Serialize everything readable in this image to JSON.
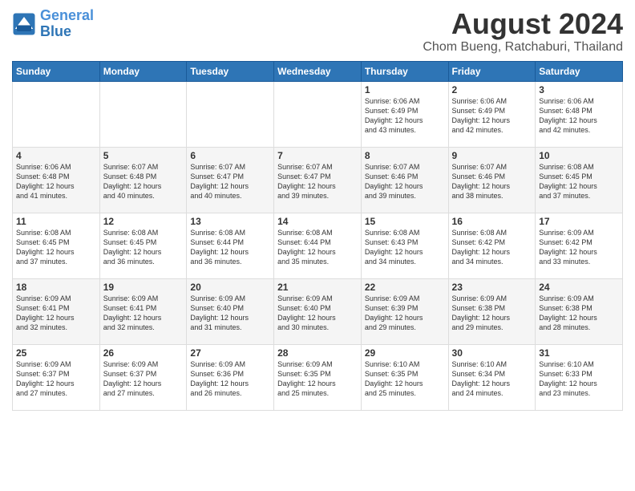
{
  "header": {
    "logo_line1": "General",
    "logo_line2": "Blue",
    "title": "August 2024",
    "subtitle": "Chom Bueng, Ratchaburi, Thailand"
  },
  "days_of_week": [
    "Sunday",
    "Monday",
    "Tuesday",
    "Wednesday",
    "Thursday",
    "Friday",
    "Saturday"
  ],
  "weeks": [
    [
      {
        "day": "",
        "info": ""
      },
      {
        "day": "",
        "info": ""
      },
      {
        "day": "",
        "info": ""
      },
      {
        "day": "",
        "info": ""
      },
      {
        "day": "1",
        "info": "Sunrise: 6:06 AM\nSunset: 6:49 PM\nDaylight: 12 hours\nand 43 minutes."
      },
      {
        "day": "2",
        "info": "Sunrise: 6:06 AM\nSunset: 6:49 PM\nDaylight: 12 hours\nand 42 minutes."
      },
      {
        "day": "3",
        "info": "Sunrise: 6:06 AM\nSunset: 6:48 PM\nDaylight: 12 hours\nand 42 minutes."
      }
    ],
    [
      {
        "day": "4",
        "info": "Sunrise: 6:06 AM\nSunset: 6:48 PM\nDaylight: 12 hours\nand 41 minutes."
      },
      {
        "day": "5",
        "info": "Sunrise: 6:07 AM\nSunset: 6:48 PM\nDaylight: 12 hours\nand 40 minutes."
      },
      {
        "day": "6",
        "info": "Sunrise: 6:07 AM\nSunset: 6:47 PM\nDaylight: 12 hours\nand 40 minutes."
      },
      {
        "day": "7",
        "info": "Sunrise: 6:07 AM\nSunset: 6:47 PM\nDaylight: 12 hours\nand 39 minutes."
      },
      {
        "day": "8",
        "info": "Sunrise: 6:07 AM\nSunset: 6:46 PM\nDaylight: 12 hours\nand 39 minutes."
      },
      {
        "day": "9",
        "info": "Sunrise: 6:07 AM\nSunset: 6:46 PM\nDaylight: 12 hours\nand 38 minutes."
      },
      {
        "day": "10",
        "info": "Sunrise: 6:08 AM\nSunset: 6:45 PM\nDaylight: 12 hours\nand 37 minutes."
      }
    ],
    [
      {
        "day": "11",
        "info": "Sunrise: 6:08 AM\nSunset: 6:45 PM\nDaylight: 12 hours\nand 37 minutes."
      },
      {
        "day": "12",
        "info": "Sunrise: 6:08 AM\nSunset: 6:45 PM\nDaylight: 12 hours\nand 36 minutes."
      },
      {
        "day": "13",
        "info": "Sunrise: 6:08 AM\nSunset: 6:44 PM\nDaylight: 12 hours\nand 36 minutes."
      },
      {
        "day": "14",
        "info": "Sunrise: 6:08 AM\nSunset: 6:44 PM\nDaylight: 12 hours\nand 35 minutes."
      },
      {
        "day": "15",
        "info": "Sunrise: 6:08 AM\nSunset: 6:43 PM\nDaylight: 12 hours\nand 34 minutes."
      },
      {
        "day": "16",
        "info": "Sunrise: 6:08 AM\nSunset: 6:42 PM\nDaylight: 12 hours\nand 34 minutes."
      },
      {
        "day": "17",
        "info": "Sunrise: 6:09 AM\nSunset: 6:42 PM\nDaylight: 12 hours\nand 33 minutes."
      }
    ],
    [
      {
        "day": "18",
        "info": "Sunrise: 6:09 AM\nSunset: 6:41 PM\nDaylight: 12 hours\nand 32 minutes."
      },
      {
        "day": "19",
        "info": "Sunrise: 6:09 AM\nSunset: 6:41 PM\nDaylight: 12 hours\nand 32 minutes."
      },
      {
        "day": "20",
        "info": "Sunrise: 6:09 AM\nSunset: 6:40 PM\nDaylight: 12 hours\nand 31 minutes."
      },
      {
        "day": "21",
        "info": "Sunrise: 6:09 AM\nSunset: 6:40 PM\nDaylight: 12 hours\nand 30 minutes."
      },
      {
        "day": "22",
        "info": "Sunrise: 6:09 AM\nSunset: 6:39 PM\nDaylight: 12 hours\nand 29 minutes."
      },
      {
        "day": "23",
        "info": "Sunrise: 6:09 AM\nSunset: 6:38 PM\nDaylight: 12 hours\nand 29 minutes."
      },
      {
        "day": "24",
        "info": "Sunrise: 6:09 AM\nSunset: 6:38 PM\nDaylight: 12 hours\nand 28 minutes."
      }
    ],
    [
      {
        "day": "25",
        "info": "Sunrise: 6:09 AM\nSunset: 6:37 PM\nDaylight: 12 hours\nand 27 minutes."
      },
      {
        "day": "26",
        "info": "Sunrise: 6:09 AM\nSunset: 6:37 PM\nDaylight: 12 hours\nand 27 minutes."
      },
      {
        "day": "27",
        "info": "Sunrise: 6:09 AM\nSunset: 6:36 PM\nDaylight: 12 hours\nand 26 minutes."
      },
      {
        "day": "28",
        "info": "Sunrise: 6:09 AM\nSunset: 6:35 PM\nDaylight: 12 hours\nand 25 minutes."
      },
      {
        "day": "29",
        "info": "Sunrise: 6:10 AM\nSunset: 6:35 PM\nDaylight: 12 hours\nand 25 minutes."
      },
      {
        "day": "30",
        "info": "Sunrise: 6:10 AM\nSunset: 6:34 PM\nDaylight: 12 hours\nand 24 minutes."
      },
      {
        "day": "31",
        "info": "Sunrise: 6:10 AM\nSunset: 6:33 PM\nDaylight: 12 hours\nand 23 minutes."
      }
    ]
  ]
}
